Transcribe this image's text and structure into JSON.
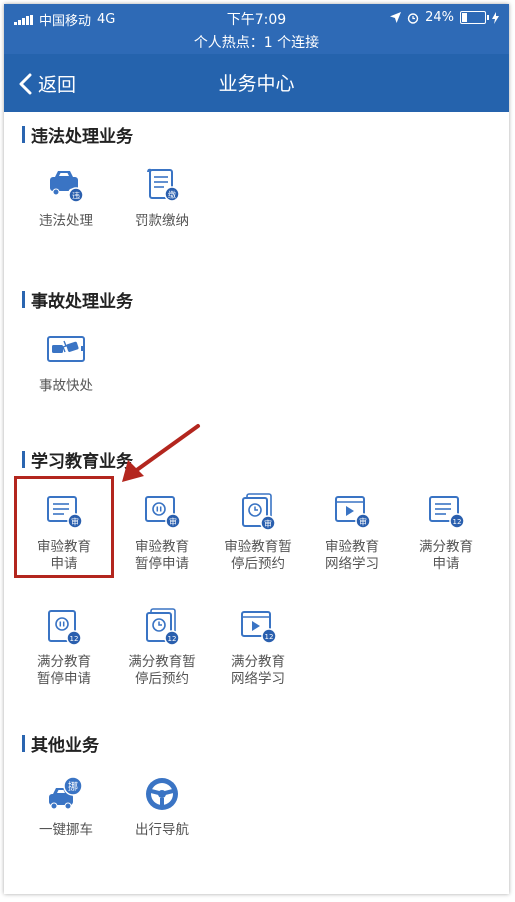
{
  "status_bar": {
    "carrier": "中国移动",
    "network": "4G",
    "time": "下午7:09",
    "battery": "24%",
    "battery_level": 0.24,
    "hotspot": "个人热点：1 个连接"
  },
  "nav": {
    "back_label": "返回",
    "title": "业务中心"
  },
  "sections": [
    {
      "title": "违法处理业务",
      "items": [
        {
          "label": "违法处理",
          "badge": "违"
        },
        {
          "label": "罚款缴纳",
          "badge": "缴"
        }
      ]
    },
    {
      "title": "事故处理业务",
      "items": [
        {
          "label": "事故快处"
        }
      ]
    },
    {
      "title": "学习教育业务",
      "items": [
        {
          "label": "审验教育\n申请",
          "badge": "审"
        },
        {
          "label": "审验教育\n暂停申请",
          "badge": "审"
        },
        {
          "label": "审验教育暂\n停后预约",
          "badge": "审"
        },
        {
          "label": "审验教育\n网络学习",
          "badge": "审"
        },
        {
          "label": "满分教育\n申请",
          "badge": "12"
        },
        {
          "label": "满分教育\n暂停申请",
          "badge": "12"
        },
        {
          "label": "满分教育暂\n停后预约",
          "badge": "12"
        },
        {
          "label": "满分教育\n网络学习",
          "badge": "12"
        }
      ]
    },
    {
      "title": "其他业务",
      "items": [
        {
          "label": "一键挪车",
          "badge": "挪"
        },
        {
          "label": "出行导航"
        }
      ]
    }
  ],
  "colors": {
    "accent": "#2e6ab6",
    "icon_blue": "#3a74c4",
    "highlight": "#b3261e"
  }
}
